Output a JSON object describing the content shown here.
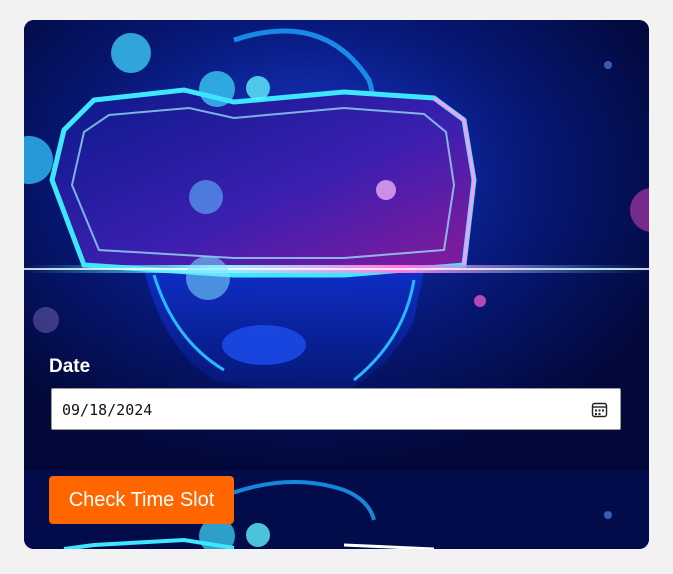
{
  "form": {
    "date_label": "Date",
    "date_value": "09/18/2024",
    "date_icon": "calendar-icon",
    "submit_label": "Check Time Slot",
    "accent_color": "#ff6600"
  },
  "background": {
    "description_icon": "vr-headset-illustration",
    "colors": {
      "deep": "#020a3a",
      "neon_cyan": "#27d8ff",
      "neon_pink": "#ff4fd8"
    }
  }
}
